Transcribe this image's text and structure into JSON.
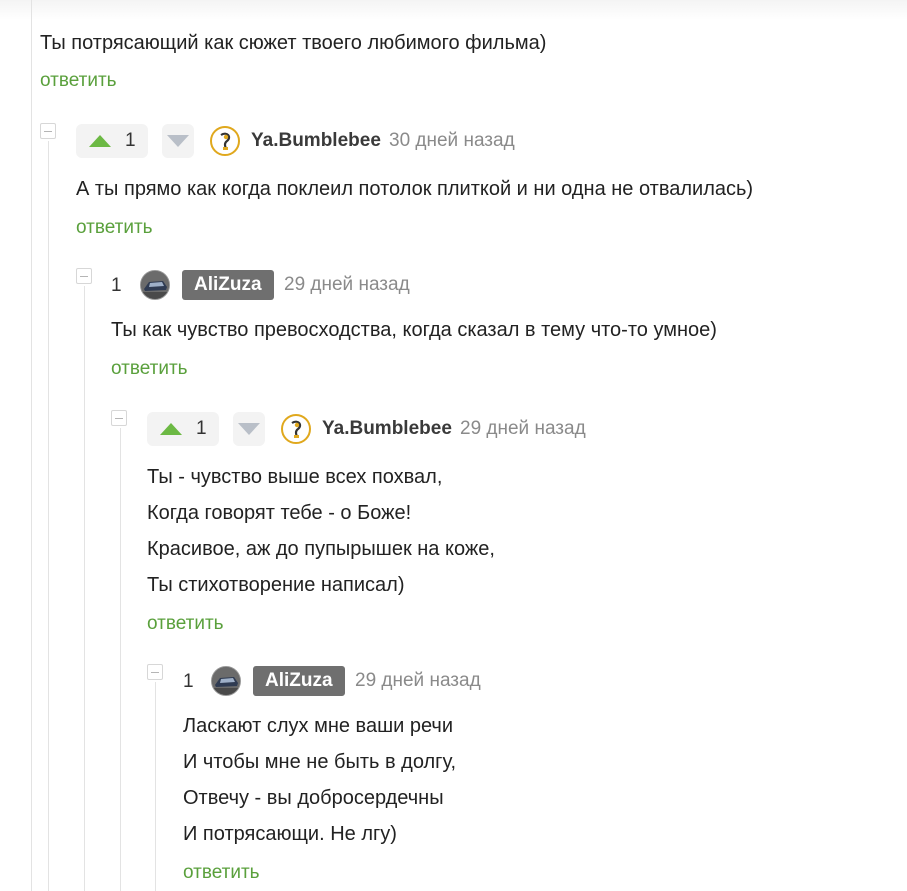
{
  "top_comment": {
    "text": "Ты потрясающий как сюжет твоего любимого фильма)",
    "reply_label": "ответить"
  },
  "comments": [
    {
      "rating": "1",
      "author": "Ya.Bumblebee",
      "time": "30 дней назад",
      "lines": [
        "А ты прямо как когда поклеил потолок плиткой и ни одна не отвалилась)"
      ],
      "reply_label": "ответить"
    },
    {
      "rating": "1",
      "author": "AliZuza",
      "time": "29 дней назад",
      "lines": [
        "Ты как чувство превосходства, когда сказал в тему что-то умное)"
      ],
      "reply_label": "ответить"
    },
    {
      "rating": "1",
      "author": "Ya.Bumblebee",
      "time": "29 дней назад",
      "lines": [
        "Ты - чувство выше всех похвал,",
        "Когда говорят тебе - о Боже!",
        "Красивое, аж до пупырышек на коже,",
        "Ты стихотворение написал)"
      ],
      "reply_label": "ответить"
    },
    {
      "rating": "1",
      "author": "AliZuza",
      "time": "29 дней назад",
      "lines": [
        "Ласкают слух мне ваши речи",
        "И чтобы мне не быть в долгу,",
        "Отвечу - вы добросердечны",
        "И потрясающи. Не лгу)"
      ],
      "reply_label": "ответить"
    }
  ],
  "colors": {
    "reply_green": "#5aa03c",
    "upvote_green": "#6cb944",
    "downvote_gray": "#b9bfc8",
    "badge_gray": "#6f6f6f"
  },
  "icons": {
    "upvote": "triangle-up-icon",
    "downvote": "triangle-down-icon",
    "collapse": "minus-square-icon"
  }
}
